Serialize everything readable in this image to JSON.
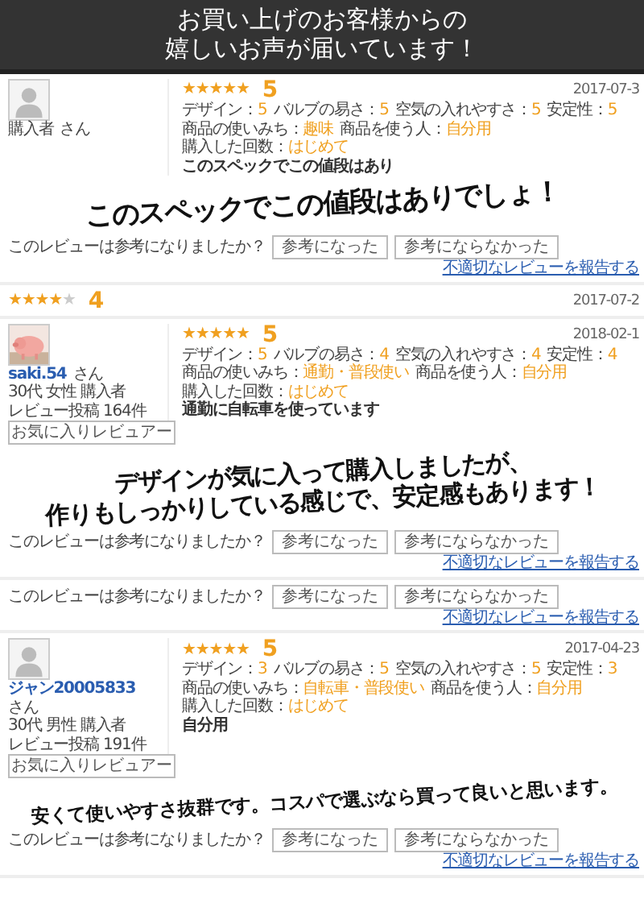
{
  "header": {
    "lines": [
      "お買い上げのお客様からの",
      "嬉しいお声が届いています！"
    ]
  },
  "reviews": [
    {
      "kind": "full",
      "user": "購入者",
      "suffix": "さん",
      "stars": 5,
      "score": "5",
      "date": "2017-07-3",
      "ratings": [
        {
          "label": "デザイン：",
          "value": "5"
        },
        {
          "label": "バルブの易さ：",
          "value": "5"
        },
        {
          "label": "空気の入れやすさ：",
          "value": "5"
        },
        {
          "label": "安定性：",
          "value": "5"
        }
      ],
      "usage": [
        {
          "label": "商品の使いみち：",
          "value": "趣味"
        },
        {
          "label": "商品を使う人：",
          "value": "自分用"
        },
        {
          "label": "購入した回数：",
          "value": "はじめて"
        }
      ],
      "title": "このスペックでこの値段はあり",
      "caption": [
        "このスペックでこの値段はありでしょ！"
      ],
      "question": "このレビューは参考になりましたか？",
      "buttons": [
        "参考になった",
        "参考にならなかった"
      ],
      "report": "不適切なレビューを報告する"
    },
    {
      "kind": "partial",
      "stars": 4,
      "score": "4",
      "date": "2017-07-2"
    },
    {
      "kind": "full",
      "photo": {
        "kind": "picture"
      },
      "user": "saki.54",
      "suffix": "さん",
      "profile": [
        "30代 女性 購入者",
        "レビュー投稿 164件"
      ],
      "fav": "お気に入りレビュアー",
      "stars": 5,
      "score": "5",
      "date": "2018-02-1",
      "ratings": [
        {
          "label": "デザイン：",
          "value": "5"
        },
        {
          "label": "バルブの易さ：",
          "value": "4"
        },
        {
          "label": "空気の入れやすさ：",
          "value": "4"
        },
        {
          "label": "安定性：",
          "value": "4"
        }
      ],
      "usage": [
        {
          "label": "商品の使いみち：",
          "value": "通勤・普段使い"
        },
        {
          "label": "商品を使う人：",
          "value": "自分用"
        },
        {
          "label": "購入した回数：",
          "value": "はじめて"
        }
      ],
      "title": "通勤に自転車を使っています",
      "caption": [
        "デザインが気に入って購入しましたが、",
        "作りもしっかりしている感じで、安定感もあります！"
      ],
      "question": "このレビューは参考になりましたか？",
      "buttons": [
        "参考になった",
        "参考にならなかった"
      ],
      "report": "不適切なレビューを報告する"
    },
    {
      "kind": "footer",
      "question": "このレビューは参考になりましたか？",
      "buttons": [
        "参考になった",
        "参考にならなかった"
      ],
      "report": "不適切なレビューを報告する"
    },
    {
      "kind": "full",
      "user": "ジャン20005833",
      "suffix": "さん",
      "profile": [
        "30代 男性 購入者",
        "レビュー投稿 191件"
      ],
      "fav": "お気に入りレビュアー",
      "stars": 5,
      "score": "5",
      "date": "2017-04-23",
      "ratings": [
        {
          "label": "デザイン：",
          "value": "3"
        },
        {
          "label": "バルブの易さ：",
          "value": "5"
        },
        {
          "label": "空気の入れやすさ：",
          "value": "5"
        },
        {
          "label": "安定性：",
          "value": "3"
        }
      ],
      "usage": [
        {
          "label": "商品の使いみち：",
          "value": "自転車・普段使い"
        },
        {
          "label": "商品を使う人：",
          "value": "自分用"
        },
        {
          "label": "購入した回数：",
          "value": "はじめて"
        }
      ],
      "title": "自分用",
      "caption": [
        "安くて使いやすさ抜群です。コスパで選ぶなら買って良いと思います。"
      ],
      "question": "このレビューは参考になりましたか？",
      "buttons": [
        "参考になった",
        "参考にならなかった"
      ],
      "report": "不適切なレビューを報告する"
    }
  ]
}
